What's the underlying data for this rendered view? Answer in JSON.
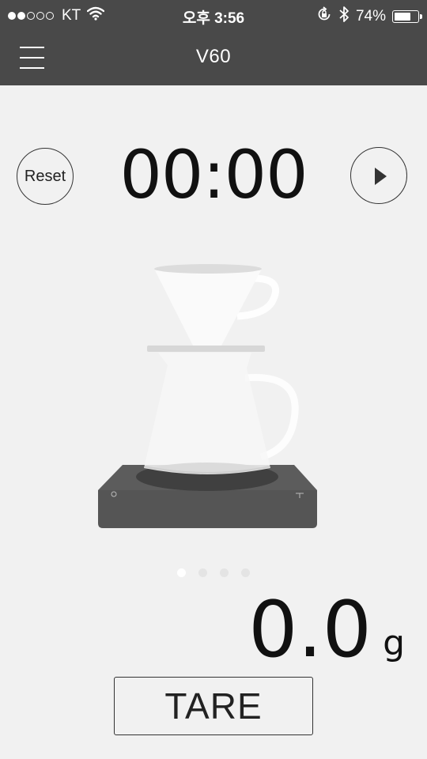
{
  "status_bar": {
    "signal_strength": 2,
    "signal_total": 5,
    "carrier": "KT",
    "time": "오후 3:56",
    "battery_percent_label": "74%",
    "battery_level": 0.74,
    "icons": [
      "wifi-icon",
      "orientation-lock-icon",
      "bluetooth-icon",
      "battery-icon"
    ]
  },
  "nav": {
    "title": "V60",
    "menu_icon": "hamburger-menu-icon"
  },
  "timer": {
    "reset_label": "Reset",
    "display": "00:00",
    "play_icon": "play-icon"
  },
  "illustration": {
    "subject": "V60 dripper on carafe on scale"
  },
  "pager": {
    "total": 4,
    "active": 0
  },
  "weight": {
    "value": "0.0",
    "unit": "g"
  },
  "tare": {
    "label": "TARE"
  },
  "colors": {
    "bar": "#494949",
    "background": "#f1f1f1",
    "scale": "#555555",
    "text": "#111111"
  }
}
